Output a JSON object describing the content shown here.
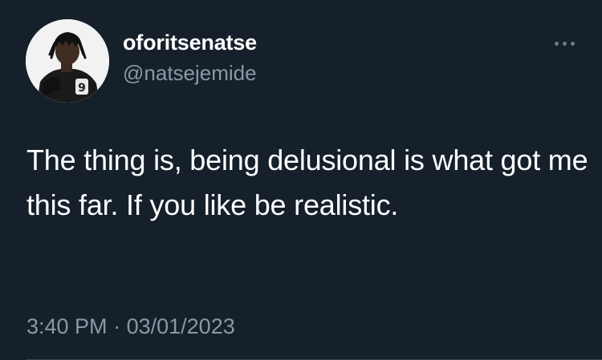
{
  "tweet": {
    "display_name": "oforitsenatse",
    "handle": "@natsejemide",
    "text": "The thing is, being delusional is what got me this far. If you like be realistic.",
    "time": "3:40 PM",
    "separator": "·",
    "date": "03/01/2023"
  },
  "icons": {
    "avatar": "profile-photo",
    "more": "more-options-ellipsis-icon"
  },
  "colors": {
    "background": "#15202b",
    "primary_text": "#ffffff",
    "secondary_text": "#8b98a5"
  }
}
